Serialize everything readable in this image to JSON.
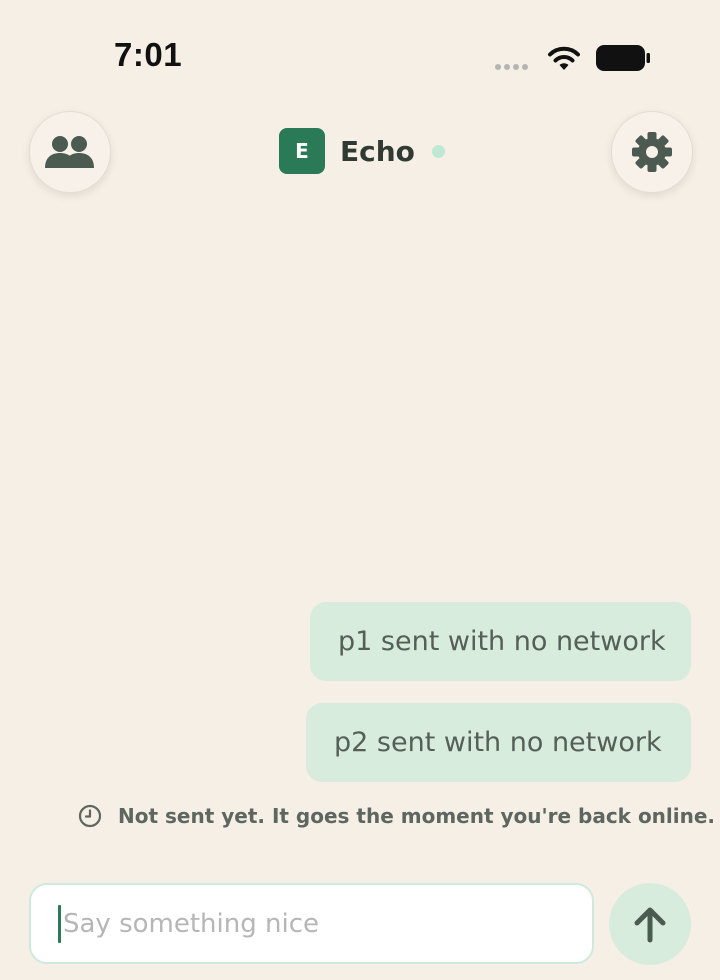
{
  "status_bar": {
    "time": "7:01",
    "icons": [
      "signal-dots-icon",
      "wifi-icon",
      "battery-icon"
    ]
  },
  "header": {
    "avatar_letter": "E",
    "app_name": "Echo",
    "presence_status": "online",
    "left_button_icon": "people-icon",
    "right_button_icon": "gear-icon",
    "accent_color": "#2a7a58"
  },
  "messages": [
    {
      "text": "p1 sent with no network"
    },
    {
      "text": "p2 sent with no network"
    }
  ],
  "pending_notice": {
    "icon": "clock-icon",
    "text": "Not sent yet. It goes the moment you're back online."
  },
  "composer": {
    "placeholder": "Say something nice",
    "value": "",
    "send_icon": "arrow-up-icon"
  },
  "colors": {
    "background": "#f6efe6",
    "bubble": "#d7ecdd",
    "accent": "#2a7a58",
    "online_dot": "#bfe8d4"
  }
}
